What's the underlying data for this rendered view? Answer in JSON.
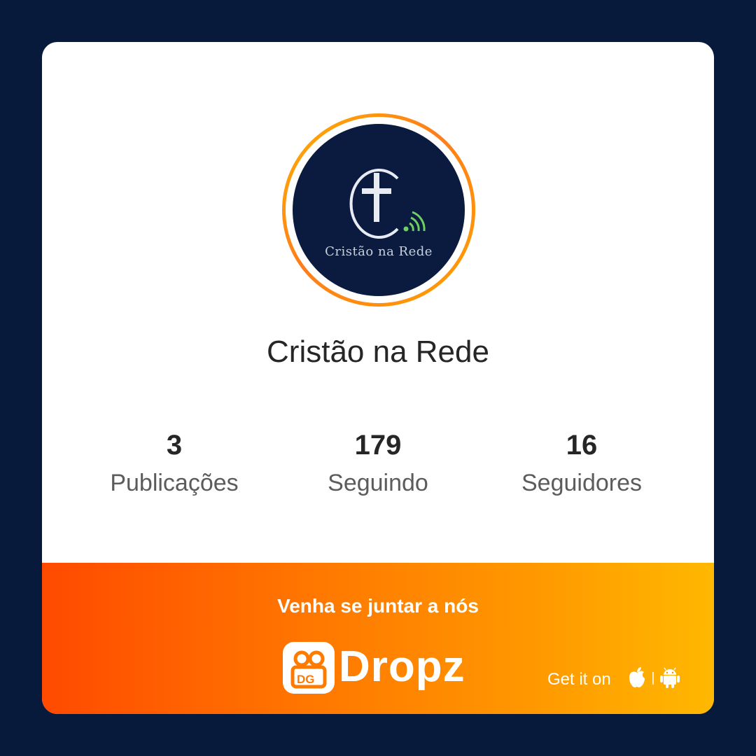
{
  "profile": {
    "name": "Cristão na Rede",
    "avatar_caption": "Cristão na Rede",
    "avatar_icon": "cross-wifi-logo-icon"
  },
  "stats": [
    {
      "value": "3",
      "label": "Publicações"
    },
    {
      "value": "179",
      "label": "Seguindo"
    },
    {
      "value": "16",
      "label": "Seguidores"
    }
  ],
  "banner": {
    "call_to_action": "Venha se juntar a nós",
    "brand": "Dropz",
    "get_it_on": "Get it on",
    "store_icons": [
      "apple-icon",
      "android-icon"
    ]
  },
  "colors": {
    "background": "#071a3c",
    "card": "#ffffff",
    "avatar_bg": "#0b1b3f",
    "ring_orange": "#ff9a1a",
    "banner_start": "#ff4a00",
    "banner_end": "#ffb800"
  }
}
